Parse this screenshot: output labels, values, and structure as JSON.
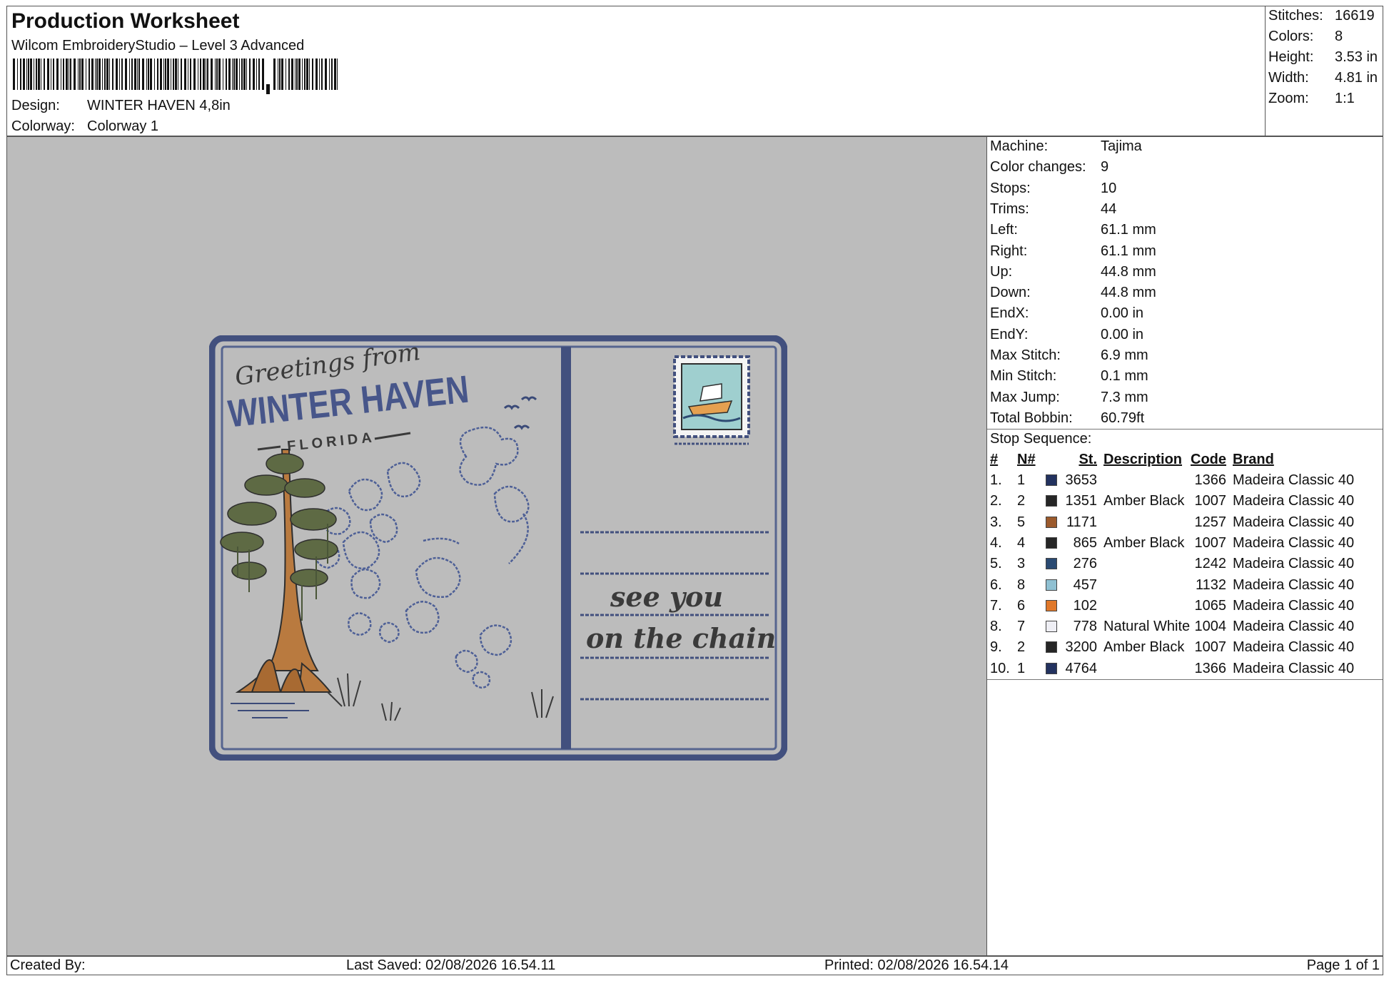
{
  "header": {
    "title": "Production Worksheet",
    "software": "Wilcom EmbroideryStudio – Level 3 Advanced",
    "design_label": "Design:",
    "design_value": "WINTER HAVEN 4,8in",
    "colorway_label": "Colorway:",
    "colorway_value": "Colorway 1"
  },
  "stats": [
    {
      "label": "Stitches:",
      "value": "16619"
    },
    {
      "label": "Colors:",
      "value": "8"
    },
    {
      "label": "Height:",
      "value": "3.53 in"
    },
    {
      "label": "Width:",
      "value": "4.81 in"
    },
    {
      "label": "Zoom:",
      "value": "1:1"
    }
  ],
  "info": [
    {
      "label": "Machine:",
      "value": "Tajima"
    },
    {
      "label": "Color changes:",
      "value": "9"
    },
    {
      "label": "Stops:",
      "value": "10"
    },
    {
      "label": "Trims:",
      "value": "44"
    },
    {
      "label": "Left:",
      "value": "61.1 mm"
    },
    {
      "label": "Right:",
      "value": "61.1 mm"
    },
    {
      "label": "Up:",
      "value": "44.8 mm"
    },
    {
      "label": "Down:",
      "value": "44.8 mm"
    },
    {
      "label": "EndX:",
      "value": "0.00 in"
    },
    {
      "label": "EndY:",
      "value": "0.00 in"
    },
    {
      "label": "Max Stitch:",
      "value": "6.9 mm"
    },
    {
      "label": "Min Stitch:",
      "value": "0.1 mm"
    },
    {
      "label": "Max Jump:",
      "value": "7.3 mm"
    },
    {
      "label": "Total Bobbin:",
      "value": "60.79ft"
    }
  ],
  "stop_sequence": {
    "title": "Stop Sequence:",
    "columns": {
      "num": "#",
      "n": "N#",
      "st": "St.",
      "desc": "Description",
      "code": "Code",
      "brand": "Brand"
    },
    "rows": [
      {
        "num": "1.",
        "n": "1",
        "color": "#23325f",
        "st": "3653",
        "desc": "",
        "code": "1366",
        "brand": "Madeira Classic 40"
      },
      {
        "num": "2.",
        "n": "2",
        "color": "#262626",
        "st": "1351",
        "desc": "Amber Black",
        "code": "1007",
        "brand": "Madeira Classic 40"
      },
      {
        "num": "3.",
        "n": "5",
        "color": "#9b5a2c",
        "st": "1171",
        "desc": "",
        "code": "1257",
        "brand": "Madeira Classic 40"
      },
      {
        "num": "4.",
        "n": "4",
        "color": "#262626",
        "st": "865",
        "desc": "Amber Black",
        "code": "1007",
        "brand": "Madeira Classic 40"
      },
      {
        "num": "5.",
        "n": "3",
        "color": "#2a4a72",
        "st": "276",
        "desc": "",
        "code": "1242",
        "brand": "Madeira Classic 40"
      },
      {
        "num": "6.",
        "n": "8",
        "color": "#8fc0d2",
        "st": "457",
        "desc": "",
        "code": "1132",
        "brand": "Madeira Classic 40"
      },
      {
        "num": "7.",
        "n": "6",
        "color": "#e0782a",
        "st": "102",
        "desc": "",
        "code": "1065",
        "brand": "Madeira Classic 40"
      },
      {
        "num": "8.",
        "n": "7",
        "color": "#eeeef4",
        "st": "778",
        "desc": "Natural White",
        "code": "1004",
        "brand": "Madeira Classic 40"
      },
      {
        "num": "9.",
        "n": "2",
        "color": "#262626",
        "st": "3200",
        "desc": "Amber Black",
        "code": "1007",
        "brand": "Madeira Classic 40"
      },
      {
        "num": "10.",
        "n": "1",
        "color": "#23325f",
        "st": "4764",
        "desc": "",
        "code": "1366",
        "brand": "Madeira Classic 40"
      }
    ]
  },
  "design_art": {
    "greeting": "Greetings from",
    "city": "WINTER HAVEN",
    "state": "FLORIDA",
    "tagline_1": "see you",
    "tagline_2": "on the chain"
  },
  "footer": {
    "created_by": "Created By:",
    "last_saved": "Last Saved: 02/08/2026 16.54.11",
    "printed": "Printed: 02/08/2026 16.54.14",
    "page": "Page 1 of 1"
  }
}
